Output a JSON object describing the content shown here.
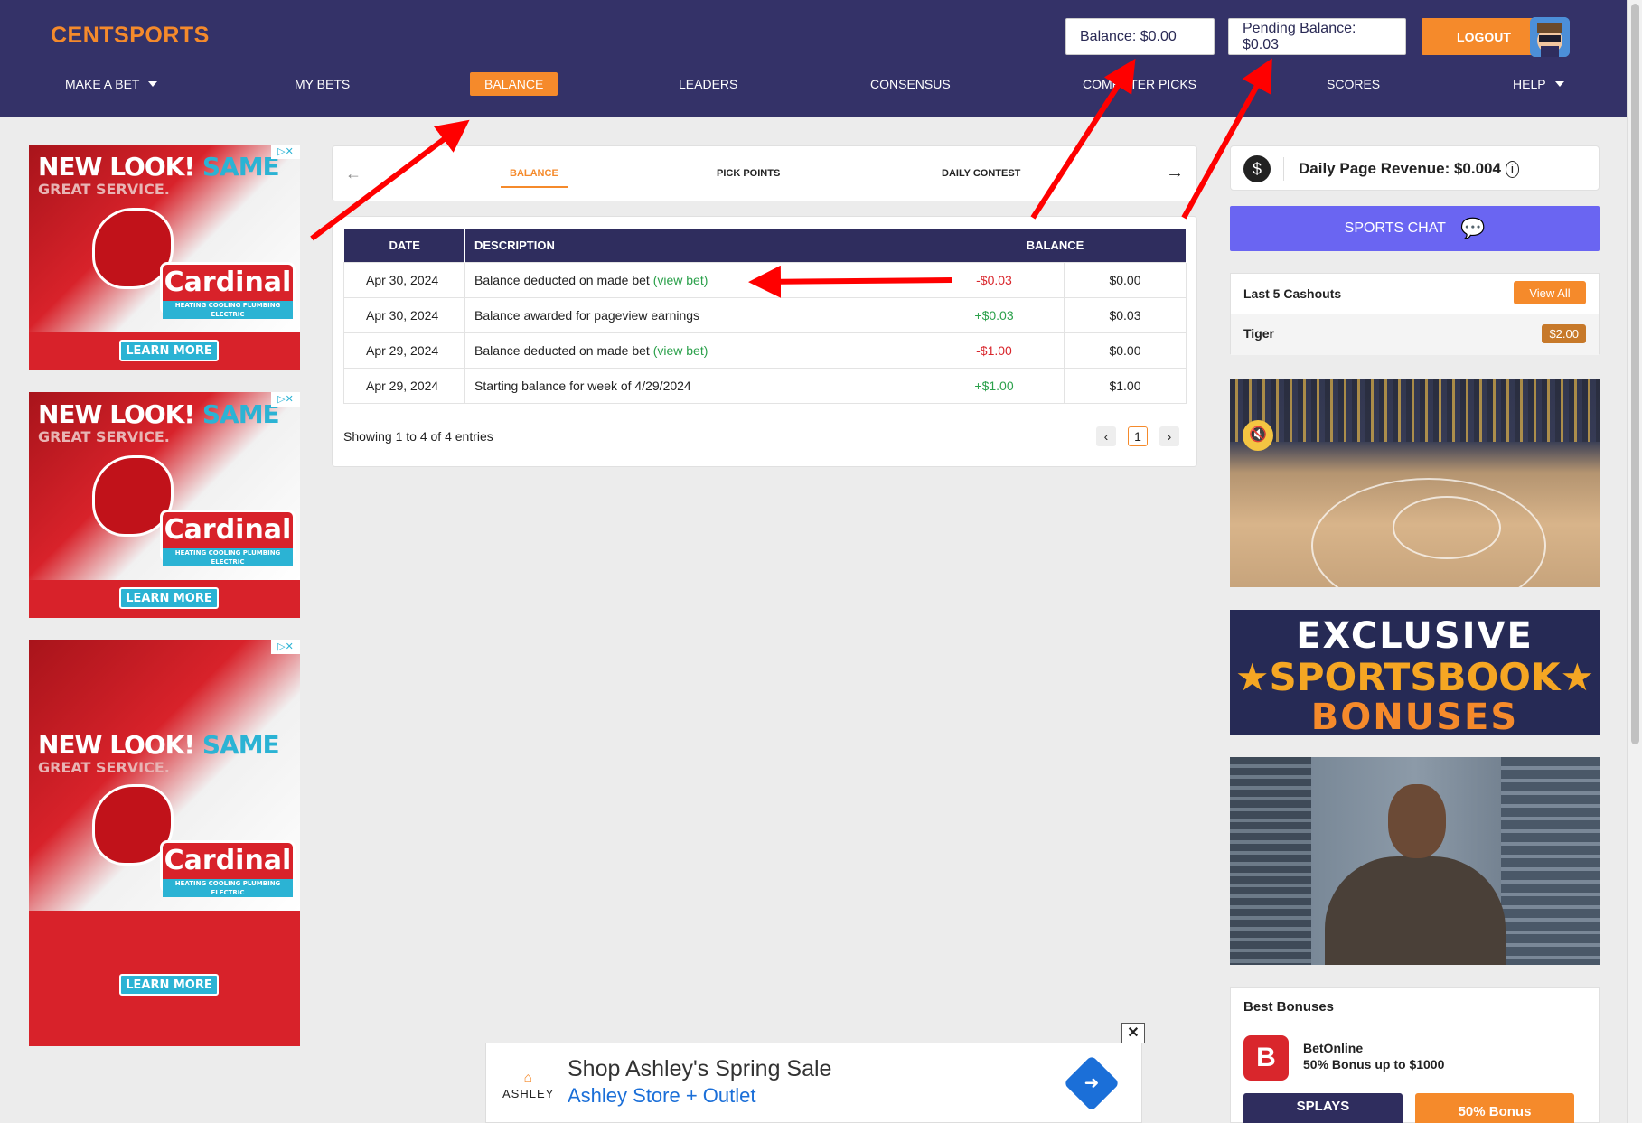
{
  "header": {
    "logo": "CENTSPORTS",
    "balance": "Balance: $0.00",
    "pending_balance": "Pending Balance: $0.03",
    "logout": "LOGOUT",
    "nav": [
      {
        "label": "MAKE A BET",
        "has_caret": true
      },
      {
        "label": "MY BETS"
      },
      {
        "label": "BALANCE",
        "active": true
      },
      {
        "label": "LEADERS"
      },
      {
        "label": "CONSENSUS"
      },
      {
        "label": "COMPUTER PICKS"
      },
      {
        "label": "SCORES"
      },
      {
        "label": "HELP",
        "has_caret": true
      }
    ]
  },
  "tabs": {
    "items": [
      "BALANCE",
      "PICK POINTS",
      "DAILY CONTEST"
    ],
    "active": "BALANCE"
  },
  "table": {
    "headers": [
      "DATE",
      "DESCRIPTION",
      "BALANCE"
    ],
    "rows": [
      {
        "date": "Apr 30, 2024",
        "description": "Balance deducted on made bet",
        "link": "(view bet)",
        "amount": "-$0.03",
        "balance": "$0.00"
      },
      {
        "date": "Apr 30, 2024",
        "description": "Balance awarded for pageview earnings",
        "link": "",
        "amount": "+$0.03",
        "balance": "$0.03"
      },
      {
        "date": "Apr 29, 2024",
        "description": "Balance deducted on made bet",
        "link": "(view bet)",
        "amount": "-$1.00",
        "balance": "$0.00"
      },
      {
        "date": "Apr 29, 2024",
        "description": "Starting balance for week of 4/29/2024",
        "link": "",
        "amount": "+$1.00",
        "balance": "$1.00"
      }
    ],
    "showing": "Showing 1 to 4 of 4 entries",
    "page": "1"
  },
  "sidebar": {
    "revenue": "Daily Page Revenue: $0.004",
    "chat": "SPORTS CHAT",
    "cashouts_title": "Last 5 Cashouts",
    "view_all": "View All",
    "cashout_name": "Tiger",
    "cashout_amount": "$2.00",
    "promo_line1": "EXCLUSIVE",
    "promo_line2": "★SPORTSBOOK★",
    "promo_line3": "BONUSES",
    "bonuses_title": "Best Bonuses",
    "bonus_name": "BetOnline",
    "bonus_offer": "50% Bonus up to $1000",
    "bonus_code_btn": "SPLAYS",
    "bonus_btn": "50% Bonus"
  },
  "left_ads": {
    "headline": "NEW LOOK!",
    "same": "SAME",
    "sub": "GREAT SERVICE.",
    "brand": "Cardinal",
    "brand_sub": "HEATING COOLING PLUMBING ELECTRIC",
    "cta": "LEARN MORE"
  },
  "bottom_ad": {
    "logo": "ASHLEY",
    "line1": "Shop Ashley's Spring Sale",
    "line2": "Ashley Store + Outlet",
    "close": "✕"
  },
  "colors": {
    "header_bg": "#343268",
    "accent": "#f58a2b",
    "negative": "#d9262c",
    "positive": "#2aa04a",
    "chat": "#6a65f2"
  }
}
